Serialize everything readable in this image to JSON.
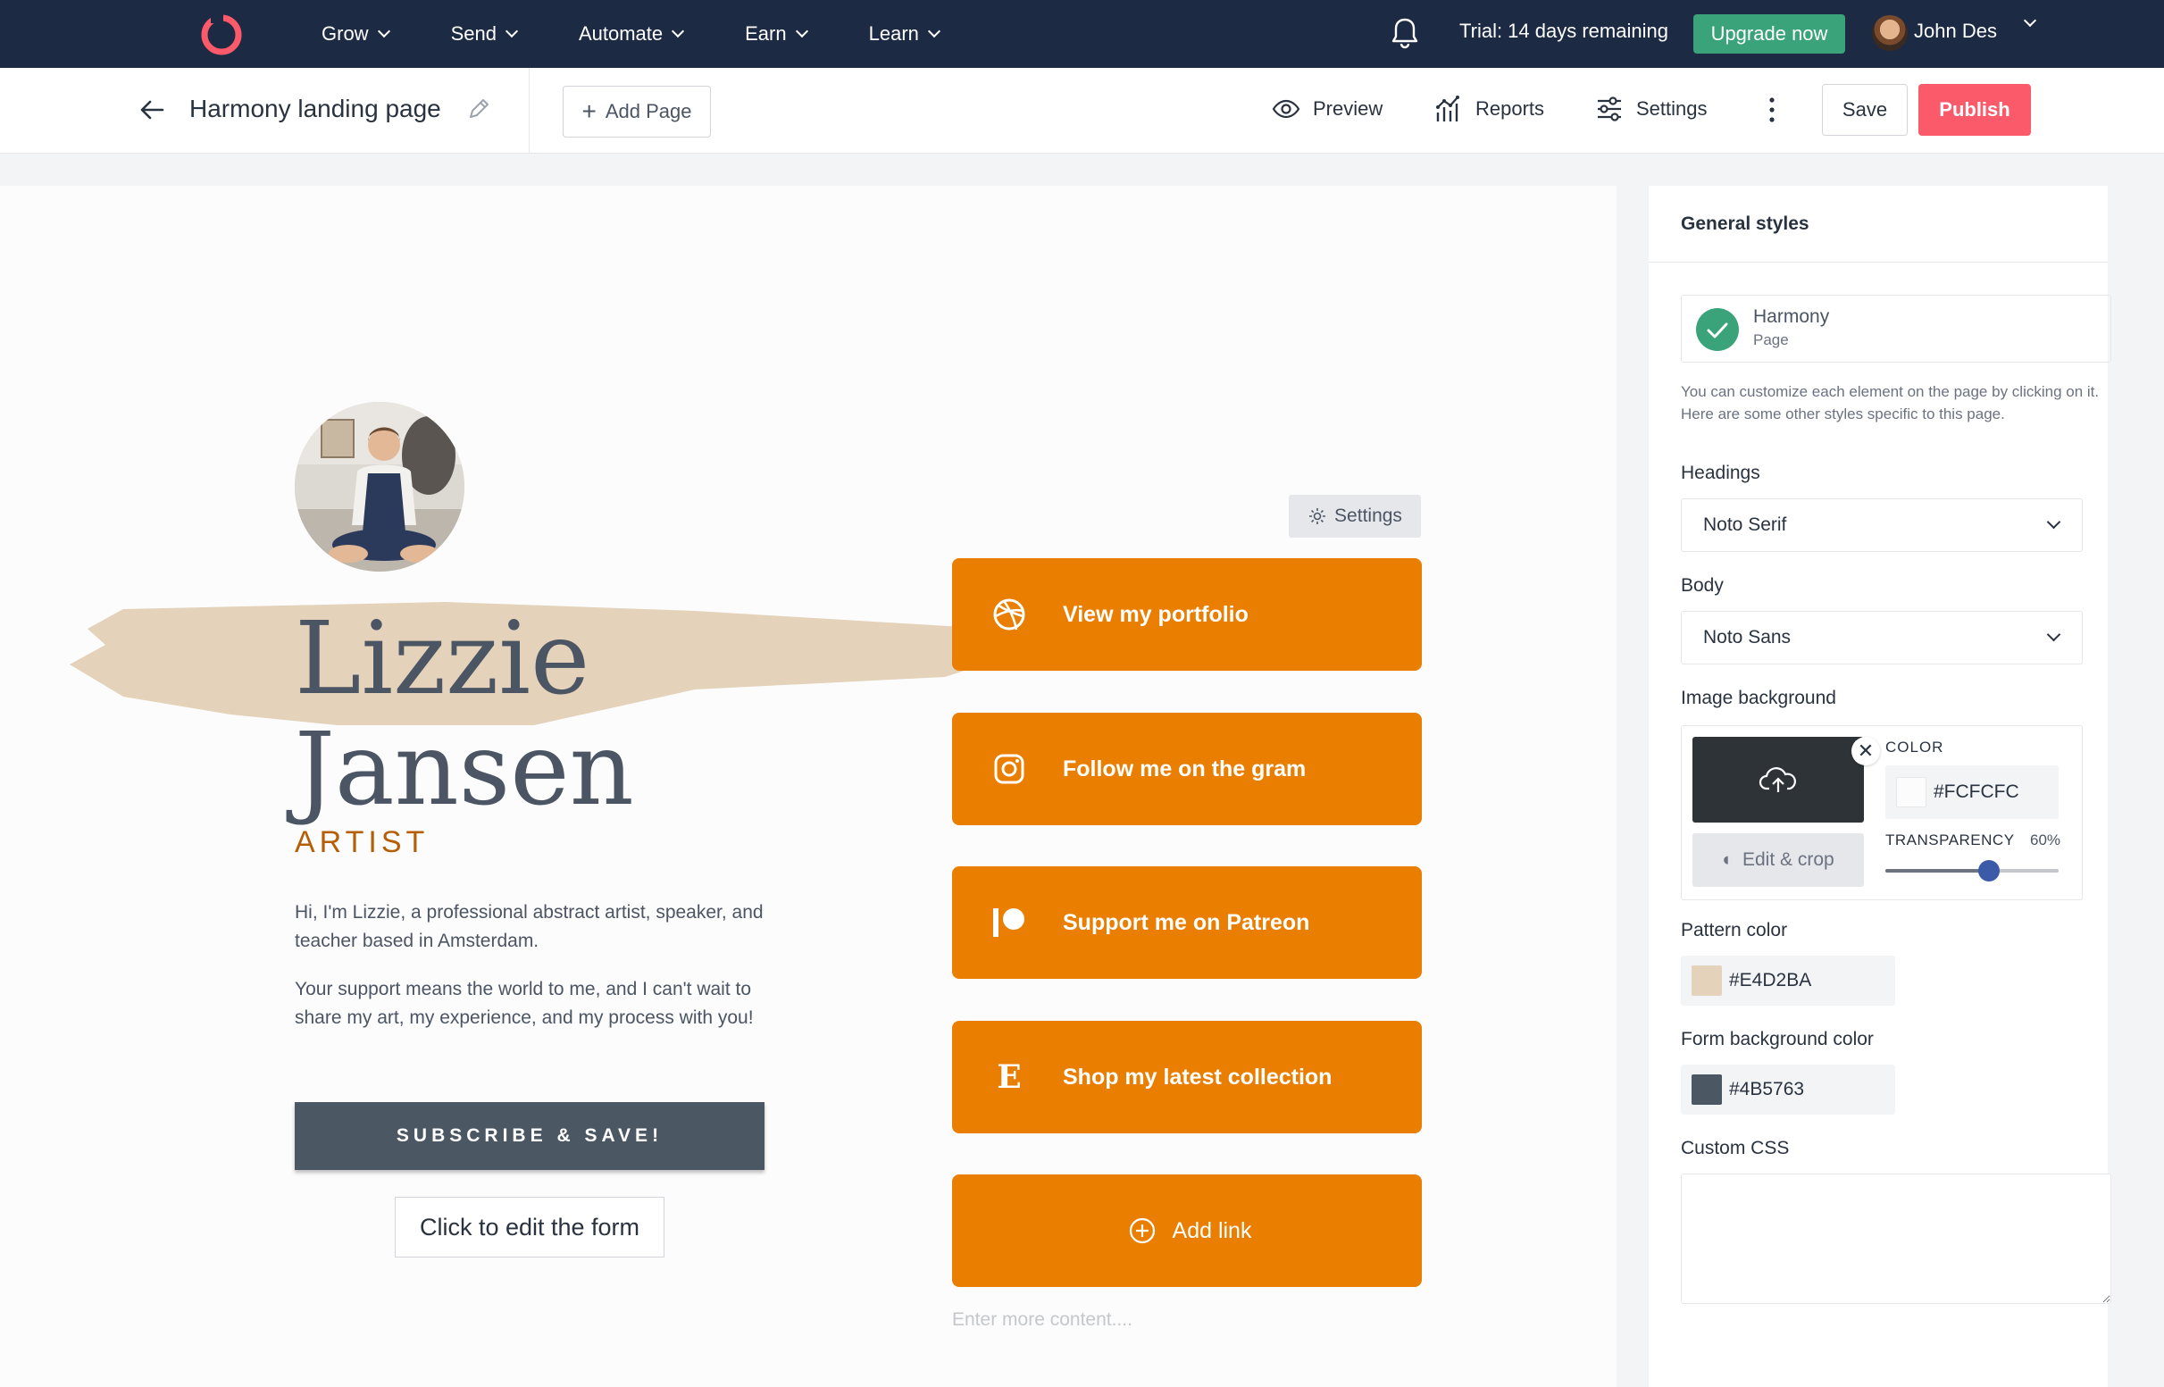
{
  "topnav": {
    "menu": [
      {
        "label": "Grow"
      },
      {
        "label": "Send"
      },
      {
        "label": "Automate"
      },
      {
        "label": "Earn"
      },
      {
        "label": "Learn"
      }
    ],
    "trial_text": "Trial: 14 days remaining",
    "upgrade_label": "Upgrade now",
    "user_name": "John Des"
  },
  "editor": {
    "page_title": "Harmony landing page",
    "add_page_label": "Add Page",
    "preview_label": "Preview",
    "reports_label": "Reports",
    "settings_label": "Settings",
    "save_label": "Save",
    "publish_label": "Publish"
  },
  "canvas": {
    "name_line1": "Lizzie",
    "name_line2": "Jansen",
    "role": "ARTIST",
    "bio": [
      "Hi, I'm Lizzie, a professional abstract artist, speaker, and teacher based in Amsterdam.",
      "Your support means the world to me, and I can't wait to share my art, my experience, and my process with you!"
    ],
    "subscribe_label": "SUBSCRIBE & SAVE!",
    "edit_form_label": "Click to edit the form",
    "settings_label": "Settings",
    "links": [
      {
        "label": "View my portfolio",
        "icon": "dribbble-icon"
      },
      {
        "label": "Follow me on the gram",
        "icon": "instagram-icon"
      },
      {
        "label": "Support me on Patreon",
        "icon": "patreon-icon"
      },
      {
        "label": "Shop my latest collection",
        "icon": "etsy-icon"
      }
    ],
    "add_link_label": "Add link",
    "enter_more_placeholder": "Enter more content....",
    "button_color": "#E97E00",
    "pattern_color": "#E4D2BA"
  },
  "panel": {
    "title": "General styles",
    "theme_name": "Harmony",
    "theme_type": "Page",
    "help_text": "You can customize each element on the page by clicking on it. Here are some other styles specific to this page.",
    "headings_label": "Headings",
    "headings_value": "Noto Serif",
    "body_label": "Body",
    "body_value": "Noto Sans",
    "image_bg_label": "Image background",
    "edit_crop_label": "Edit & crop",
    "color_label": "COLOR",
    "color_value": "#FCFCFC",
    "transparency_label": "TRANSPARENCY",
    "transparency_value": "60%",
    "transparency_fraction": 0.6,
    "pattern_color_label": "Pattern color",
    "pattern_color_value": "#E4D2BA",
    "form_bg_label": "Form background color",
    "form_bg_value": "#4B5763",
    "custom_css_label": "Custom CSS"
  }
}
